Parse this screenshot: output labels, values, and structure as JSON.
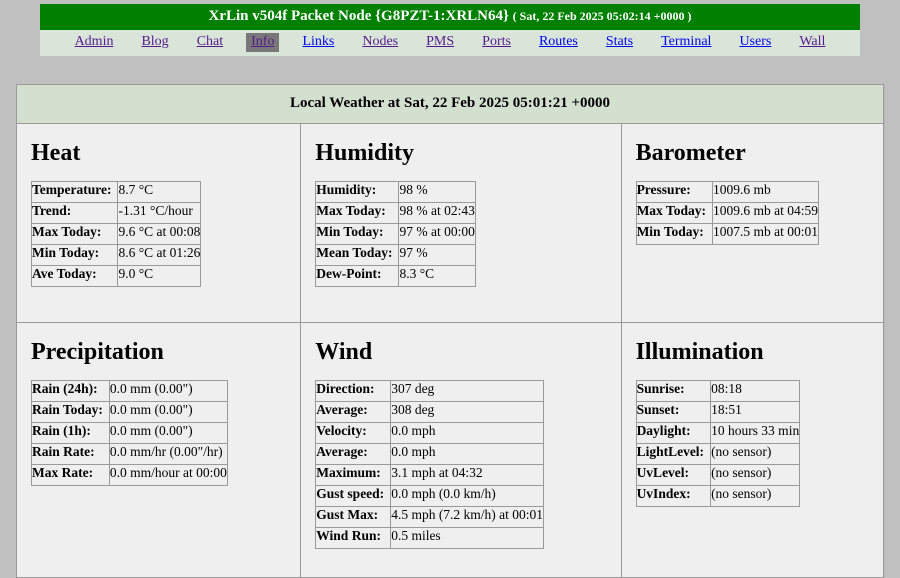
{
  "header": {
    "title_main": "XrLin v504f Packet Node {G8PZT-1:XRLN64}",
    "title_date": "( Sat, 22 Feb 2025 05:02:14 +0000 )",
    "colors": {
      "title_bar_bg": "#008000",
      "nav_bg": "#d9e5d9",
      "current_tab_bg": "#787878",
      "visited_link": "#551a8b",
      "link": "#0000ee",
      "page_bg": "#c0c0c0"
    },
    "nav": [
      {
        "label": "Admin",
        "state": "visited"
      },
      {
        "label": "Blog",
        "state": "visited"
      },
      {
        "label": "Chat",
        "state": "visited"
      },
      {
        "label": "Info",
        "state": "current"
      },
      {
        "label": "Links",
        "state": "unvisited"
      },
      {
        "label": "Nodes",
        "state": "visited"
      },
      {
        "label": "PMS",
        "state": "visited"
      },
      {
        "label": "Ports",
        "state": "visited"
      },
      {
        "label": "Routes",
        "state": "unvisited"
      },
      {
        "label": "Stats",
        "state": "unvisited"
      },
      {
        "label": "Terminal",
        "state": "unvisited"
      },
      {
        "label": "Users",
        "state": "unvisited"
      },
      {
        "label": "Wall",
        "state": "visited"
      }
    ]
  },
  "weather": {
    "caption": "Local Weather at Sat, 22 Feb 2025 05:01:21 +0000",
    "panels": {
      "heat": {
        "title": "Heat",
        "rows": [
          {
            "key": "Temperature:",
            "value": "8.7 °C"
          },
          {
            "key": "Trend:",
            "value": "-1.31 °C/hour"
          },
          {
            "key": "Max Today:",
            "value": "9.6 °C at 00:08"
          },
          {
            "key": "Min Today:",
            "value": "8.6 °C at 01:26"
          },
          {
            "key": "Ave Today:",
            "value": "9.0 °C"
          }
        ]
      },
      "humidity": {
        "title": "Humidity",
        "rows": [
          {
            "key": "Humidity:",
            "value": "98 %"
          },
          {
            "key": "Max Today:",
            "value": "98 % at 02:43"
          },
          {
            "key": "Min Today:",
            "value": "97 % at 00:00"
          },
          {
            "key": "Mean Today:",
            "value": "97 %"
          },
          {
            "key": "Dew-Point:",
            "value": "8.3 °C"
          }
        ]
      },
      "barometer": {
        "title": "Barometer",
        "rows": [
          {
            "key": "Pressure:",
            "value": "1009.6 mb"
          },
          {
            "key": "Max Today:",
            "value": "1009.6 mb at 04:59"
          },
          {
            "key": "Min Today:",
            "value": "1007.5 mb at 00:01"
          }
        ]
      },
      "precipitation": {
        "title": "Precipitation",
        "rows": [
          {
            "key": "Rain (24h):",
            "value": "0.0 mm (0.00\")"
          },
          {
            "key": "Rain Today:",
            "value": "0.0 mm (0.00\")"
          },
          {
            "key": "Rain (1h):",
            "value": "0.0 mm (0.00\")"
          },
          {
            "key": "Rain Rate:",
            "value": "0.0 mm/hr (0.00\"/hr)"
          },
          {
            "key": "Max Rate:",
            "value": "0.0 mm/hour at 00:00"
          }
        ]
      },
      "wind": {
        "title": "Wind",
        "rows": [
          {
            "key": "Direction:",
            "value": "307 deg"
          },
          {
            "key": "Average:",
            "value": "308 deg"
          },
          {
            "key": "Velocity:",
            "value": "0.0 mph"
          },
          {
            "key": "Average:",
            "value": "0.0 mph"
          },
          {
            "key": "Maximum:",
            "value": "3.1 mph at 04:32"
          },
          {
            "key": "Gust speed:",
            "value": "0.0 mph (0.0 km/h)"
          },
          {
            "key": "Gust Max:",
            "value": "4.5 mph (7.2 km/h) at 00:01"
          },
          {
            "key": "Wind Run:",
            "value": "0.5 miles"
          }
        ]
      },
      "illumination": {
        "title": "Illumination",
        "rows": [
          {
            "key": "Sunrise:",
            "value": "08:18"
          },
          {
            "key": "Sunset:",
            "value": "18:51"
          },
          {
            "key": "Daylight:",
            "value": "10 hours 33 min"
          },
          {
            "key": "LightLevel:",
            "value": "(no sensor)"
          },
          {
            "key": "UvLevel:",
            "value": "(no sensor)"
          },
          {
            "key": "UvIndex:",
            "value": "(no sensor)"
          }
        ]
      }
    }
  }
}
